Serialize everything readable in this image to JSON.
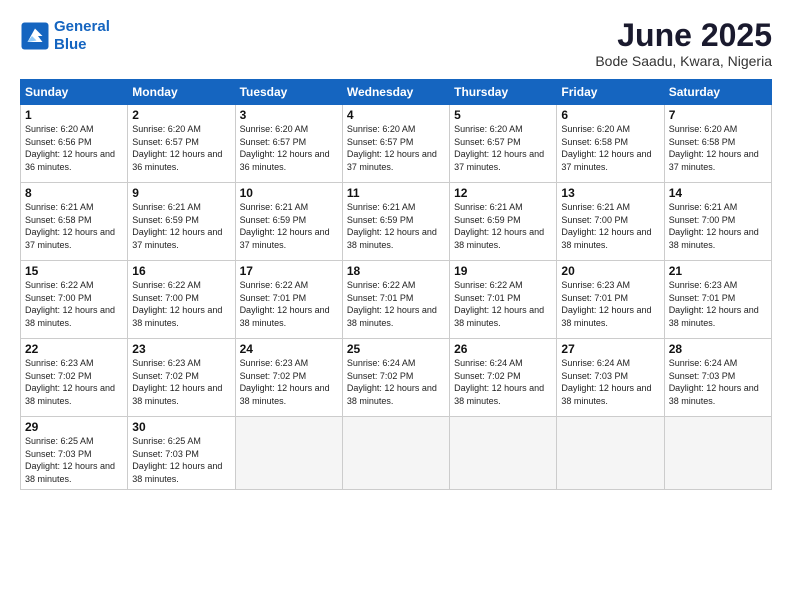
{
  "header": {
    "logo_line1": "General",
    "logo_line2": "Blue",
    "month": "June 2025",
    "location": "Bode Saadu, Kwara, Nigeria"
  },
  "days_of_week": [
    "Sunday",
    "Monday",
    "Tuesday",
    "Wednesday",
    "Thursday",
    "Friday",
    "Saturday"
  ],
  "weeks": [
    [
      {
        "day": 1,
        "sunrise": "6:20 AM",
        "sunset": "6:56 PM",
        "daylight": "12 hours and 36 minutes."
      },
      {
        "day": 2,
        "sunrise": "6:20 AM",
        "sunset": "6:57 PM",
        "daylight": "12 hours and 36 minutes."
      },
      {
        "day": 3,
        "sunrise": "6:20 AM",
        "sunset": "6:57 PM",
        "daylight": "12 hours and 36 minutes."
      },
      {
        "day": 4,
        "sunrise": "6:20 AM",
        "sunset": "6:57 PM",
        "daylight": "12 hours and 37 minutes."
      },
      {
        "day": 5,
        "sunrise": "6:20 AM",
        "sunset": "6:57 PM",
        "daylight": "12 hours and 37 minutes."
      },
      {
        "day": 6,
        "sunrise": "6:20 AM",
        "sunset": "6:58 PM",
        "daylight": "12 hours and 37 minutes."
      },
      {
        "day": 7,
        "sunrise": "6:20 AM",
        "sunset": "6:58 PM",
        "daylight": "12 hours and 37 minutes."
      }
    ],
    [
      {
        "day": 8,
        "sunrise": "6:21 AM",
        "sunset": "6:58 PM",
        "daylight": "12 hours and 37 minutes."
      },
      {
        "day": 9,
        "sunrise": "6:21 AM",
        "sunset": "6:59 PM",
        "daylight": "12 hours and 37 minutes."
      },
      {
        "day": 10,
        "sunrise": "6:21 AM",
        "sunset": "6:59 PM",
        "daylight": "12 hours and 37 minutes."
      },
      {
        "day": 11,
        "sunrise": "6:21 AM",
        "sunset": "6:59 PM",
        "daylight": "12 hours and 38 minutes."
      },
      {
        "day": 12,
        "sunrise": "6:21 AM",
        "sunset": "6:59 PM",
        "daylight": "12 hours and 38 minutes."
      },
      {
        "day": 13,
        "sunrise": "6:21 AM",
        "sunset": "7:00 PM",
        "daylight": "12 hours and 38 minutes."
      },
      {
        "day": 14,
        "sunrise": "6:21 AM",
        "sunset": "7:00 PM",
        "daylight": "12 hours and 38 minutes."
      }
    ],
    [
      {
        "day": 15,
        "sunrise": "6:22 AM",
        "sunset": "7:00 PM",
        "daylight": "12 hours and 38 minutes."
      },
      {
        "day": 16,
        "sunrise": "6:22 AM",
        "sunset": "7:00 PM",
        "daylight": "12 hours and 38 minutes."
      },
      {
        "day": 17,
        "sunrise": "6:22 AM",
        "sunset": "7:01 PM",
        "daylight": "12 hours and 38 minutes."
      },
      {
        "day": 18,
        "sunrise": "6:22 AM",
        "sunset": "7:01 PM",
        "daylight": "12 hours and 38 minutes."
      },
      {
        "day": 19,
        "sunrise": "6:22 AM",
        "sunset": "7:01 PM",
        "daylight": "12 hours and 38 minutes."
      },
      {
        "day": 20,
        "sunrise": "6:23 AM",
        "sunset": "7:01 PM",
        "daylight": "12 hours and 38 minutes."
      },
      {
        "day": 21,
        "sunrise": "6:23 AM",
        "sunset": "7:01 PM",
        "daylight": "12 hours and 38 minutes."
      }
    ],
    [
      {
        "day": 22,
        "sunrise": "6:23 AM",
        "sunset": "7:02 PM",
        "daylight": "12 hours and 38 minutes."
      },
      {
        "day": 23,
        "sunrise": "6:23 AM",
        "sunset": "7:02 PM",
        "daylight": "12 hours and 38 minutes."
      },
      {
        "day": 24,
        "sunrise": "6:23 AM",
        "sunset": "7:02 PM",
        "daylight": "12 hours and 38 minutes."
      },
      {
        "day": 25,
        "sunrise": "6:24 AM",
        "sunset": "7:02 PM",
        "daylight": "12 hours and 38 minutes."
      },
      {
        "day": 26,
        "sunrise": "6:24 AM",
        "sunset": "7:02 PM",
        "daylight": "12 hours and 38 minutes."
      },
      {
        "day": 27,
        "sunrise": "6:24 AM",
        "sunset": "7:03 PM",
        "daylight": "12 hours and 38 minutes."
      },
      {
        "day": 28,
        "sunrise": "6:24 AM",
        "sunset": "7:03 PM",
        "daylight": "12 hours and 38 minutes."
      }
    ],
    [
      {
        "day": 29,
        "sunrise": "6:25 AM",
        "sunset": "7:03 PM",
        "daylight": "12 hours and 38 minutes."
      },
      {
        "day": 30,
        "sunrise": "6:25 AM",
        "sunset": "7:03 PM",
        "daylight": "12 hours and 38 minutes."
      },
      null,
      null,
      null,
      null,
      null
    ]
  ]
}
